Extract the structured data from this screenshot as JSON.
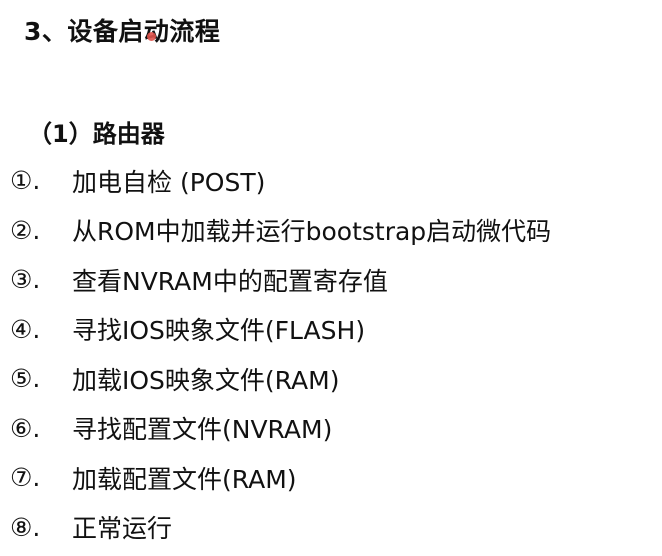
{
  "section_title": "3、设备启动流程",
  "sub_title": "（1）路由器",
  "steps": [
    {
      "num": "①.",
      "text": "加电自检 (POST)"
    },
    {
      "num": "②.",
      "text": "从ROM中加载并运行bootstrap启动微代码"
    },
    {
      "num": "③.",
      "text": "查看NVRAM中的配置寄存值"
    },
    {
      "num": "④.",
      "text": "寻找IOS映象文件(FLASH)"
    },
    {
      "num": "⑤.",
      "text": "加载IOS映象文件(RAM)"
    },
    {
      "num": "⑥.",
      "text": "寻找配置文件(NVRAM)"
    },
    {
      "num": "⑦.",
      "text": "加载配置文件(RAM)"
    },
    {
      "num": "⑧.",
      "text": "正常运行"
    }
  ],
  "colors": {
    "text": "#111111",
    "background": "#ffffff",
    "pointer": "#e0524a"
  }
}
